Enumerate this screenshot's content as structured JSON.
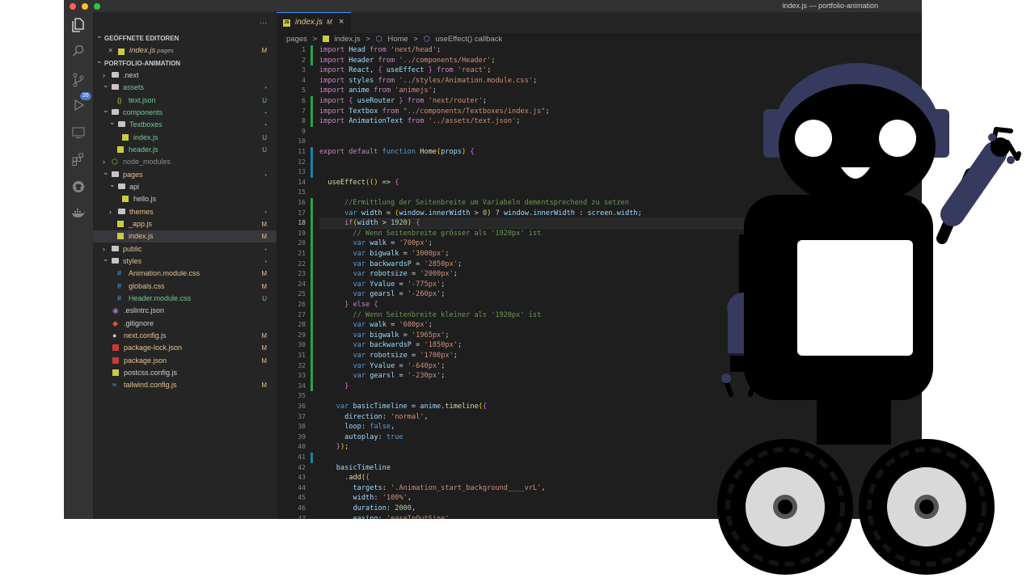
{
  "window": {
    "title": "index.js — portfolio-animation"
  },
  "activity_bar": {
    "items": [
      "files-icon",
      "search-icon",
      "source-control-icon",
      "run-debug-icon",
      "remote-explorer-icon",
      "extensions-icon",
      "github-icon",
      "docker-icon"
    ],
    "scm_badge": "26"
  },
  "sidebar": {
    "more": "···",
    "open_editors_title": "GEÖFFNETE EDITOREN",
    "open_editor": {
      "name": "index.js",
      "folder": "pages",
      "status": "M"
    },
    "project_title": "PORTFOLIO-ANIMATION",
    "tree": [
      {
        "name": ".next",
        "status": ""
      },
      {
        "name": "assets",
        "status": "•"
      },
      {
        "name": "text.json",
        "status": "U"
      },
      {
        "name": "components",
        "status": "•"
      },
      {
        "name": "Textboxes",
        "status": "•"
      },
      {
        "name": "index.js",
        "status": "U"
      },
      {
        "name": "header.js",
        "status": "U"
      },
      {
        "name": "node_modules",
        "status": ""
      },
      {
        "name": "pages",
        "status": "•"
      },
      {
        "name": "api",
        "status": ""
      },
      {
        "name": "hello.js",
        "status": ""
      },
      {
        "name": "themes",
        "status": "•"
      },
      {
        "name": "_app.js",
        "status": "M"
      },
      {
        "name": "index.js",
        "status": "M"
      },
      {
        "name": "public",
        "status": "•"
      },
      {
        "name": "styles",
        "status": "•"
      },
      {
        "name": "Animation.module.css",
        "status": "M"
      },
      {
        "name": "globals.css",
        "status": "M"
      },
      {
        "name": "Header.module.css",
        "status": "U"
      },
      {
        "name": ".eslintrc.json",
        "status": ""
      },
      {
        "name": ".gitignore",
        "status": ""
      },
      {
        "name": "next.config.js",
        "status": "M"
      },
      {
        "name": "package-lock.json",
        "status": "M"
      },
      {
        "name": "package.json",
        "status": "M"
      },
      {
        "name": "postcss.config.js",
        "status": ""
      },
      {
        "name": "tailwind.config.js",
        "status": "M"
      }
    ]
  },
  "editor": {
    "tab": {
      "label": "index.js",
      "status": "M",
      "close": "×",
      "icon_text": "JS"
    },
    "breadcrumb": [
      "pages",
      ">",
      "index.js",
      ">",
      "Home",
      ">",
      "useEffect() callback"
    ],
    "current_line": "18",
    "lines": [
      {
        "n": "1",
        "t": "import Head from 'next/head';"
      },
      {
        "n": "2",
        "t": "import Header from '../components/Header';"
      },
      {
        "n": "3",
        "t": "import React, { useEffect } from 'react';"
      },
      {
        "n": "4",
        "t": "import styles from '../styles/Animation.module.css';"
      },
      {
        "n": "5",
        "t": "import anime from 'animejs';"
      },
      {
        "n": "6",
        "t": "import { useRouter } from 'next/router';"
      },
      {
        "n": "7",
        "t": "import Textbox from \"../components/Textboxes/index.js\";"
      },
      {
        "n": "8",
        "t": "import AnimationText from '../assets/text.json';"
      },
      {
        "n": "9",
        "t": ""
      },
      {
        "n": "10",
        "t": ""
      },
      {
        "n": "11",
        "t": "export default function Home(props) {"
      },
      {
        "n": "12",
        "t": ""
      },
      {
        "n": "13",
        "t": ""
      },
      {
        "n": "14",
        "t": "  useEffect(() => {"
      },
      {
        "n": "15",
        "t": ""
      },
      {
        "n": "16",
        "t": "      //Ermittlung der Seitenbreite um Variabeln dementsprechend zu setzen"
      },
      {
        "n": "17",
        "t": "      var width = (window.innerWidth > 0) ? window.innerWidth : screen.width;"
      },
      {
        "n": "18",
        "t": "      if(width > 1920) {"
      },
      {
        "n": "19",
        "t": "        // Wenn Seitenbreite grösser als '1920px' ist"
      },
      {
        "n": "20",
        "t": "        var walk = '700px';"
      },
      {
        "n": "21",
        "t": "        var bigwalk = '3000px';"
      },
      {
        "n": "22",
        "t": "        var backwardsP = '2850px';"
      },
      {
        "n": "23",
        "t": "        var robotsize = '2000px';"
      },
      {
        "n": "24",
        "t": "        var Yvalue = '-775px';"
      },
      {
        "n": "25",
        "t": "        var gearsl = '-260px';"
      },
      {
        "n": "26",
        "t": "      } else {"
      },
      {
        "n": "27",
        "t": "        // Wenn Seitenbreite kleiner als '1920px' ist"
      },
      {
        "n": "28",
        "t": "        var walk = '600px';"
      },
      {
        "n": "29",
        "t": "        var bigwalk = '1965px';"
      },
      {
        "n": "30",
        "t": "        var backwardsP = '1850px';"
      },
      {
        "n": "31",
        "t": "        var robotsize = '1700px';"
      },
      {
        "n": "32",
        "t": "        var Yvalue = '-640px';"
      },
      {
        "n": "33",
        "t": "        var gearsl = '-230px';"
      },
      {
        "n": "34",
        "t": "      }"
      },
      {
        "n": "35",
        "t": ""
      },
      {
        "n": "36",
        "t": "    var basicTimeline = anime.timeline({"
      },
      {
        "n": "37",
        "t": "      direction: 'normal',"
      },
      {
        "n": "38",
        "t": "      loop: false,"
      },
      {
        "n": "39",
        "t": "      autoplay: true"
      },
      {
        "n": "40",
        "t": "    });"
      },
      {
        "n": "41",
        "t": ""
      },
      {
        "n": "42",
        "t": "    basicTimeline"
      },
      {
        "n": "43",
        "t": "      .add({"
      },
      {
        "n": "44",
        "t": "        targets: '.Animation_start_background____vrL',"
      },
      {
        "n": "45",
        "t": "        width: '100%',"
      },
      {
        "n": "46",
        "t": "        duration: 2000,"
      },
      {
        "n": "47",
        "t": "        easing: 'easeInOutSine',"
      }
    ]
  },
  "colors": {
    "modified": "#e2c08d",
    "untracked": "#73c991",
    "folder_text": "#cccccc",
    "robot_body": "#000000",
    "robot_accent": "#353a5e",
    "wheel_gray": "#d9d9d9"
  }
}
